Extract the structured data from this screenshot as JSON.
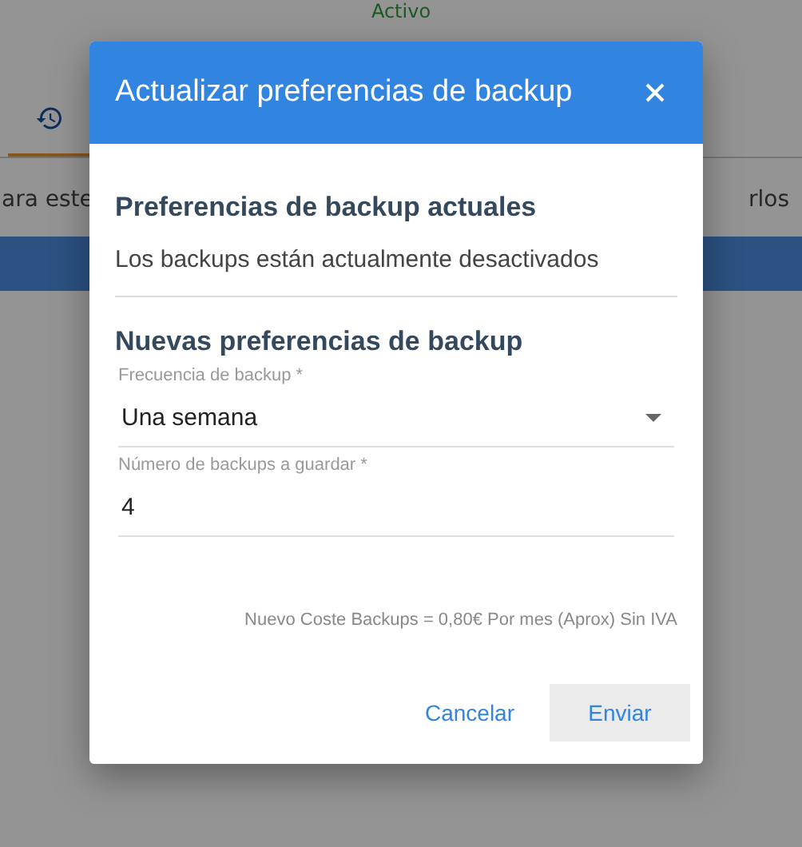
{
  "background": {
    "status": "Activo",
    "tab": {
      "selected": true
    },
    "text_left": "ara este",
    "text_right": "rlos"
  },
  "dialog": {
    "title": "Actualizar preferencias de backup",
    "current_heading": "Preferencias de backup actuales",
    "current_text": "Los backups están actualmente desactivados",
    "new_heading": "Nuevas preferencias de backup",
    "fields": [
      {
        "kind": "select",
        "label": "Frecuencia de backup *",
        "value": "Una semana"
      },
      {
        "kind": "input",
        "label": "Número de backups a guardar *",
        "value": "4"
      }
    ],
    "cost": "Nuevo Coste Backups = 0,80€ Por mes (Aprox) Sin IVA",
    "buttons": [
      {
        "label": "Cancelar",
        "kind": "text"
      },
      {
        "label": "Enviar",
        "kind": "filled"
      }
    ]
  }
}
